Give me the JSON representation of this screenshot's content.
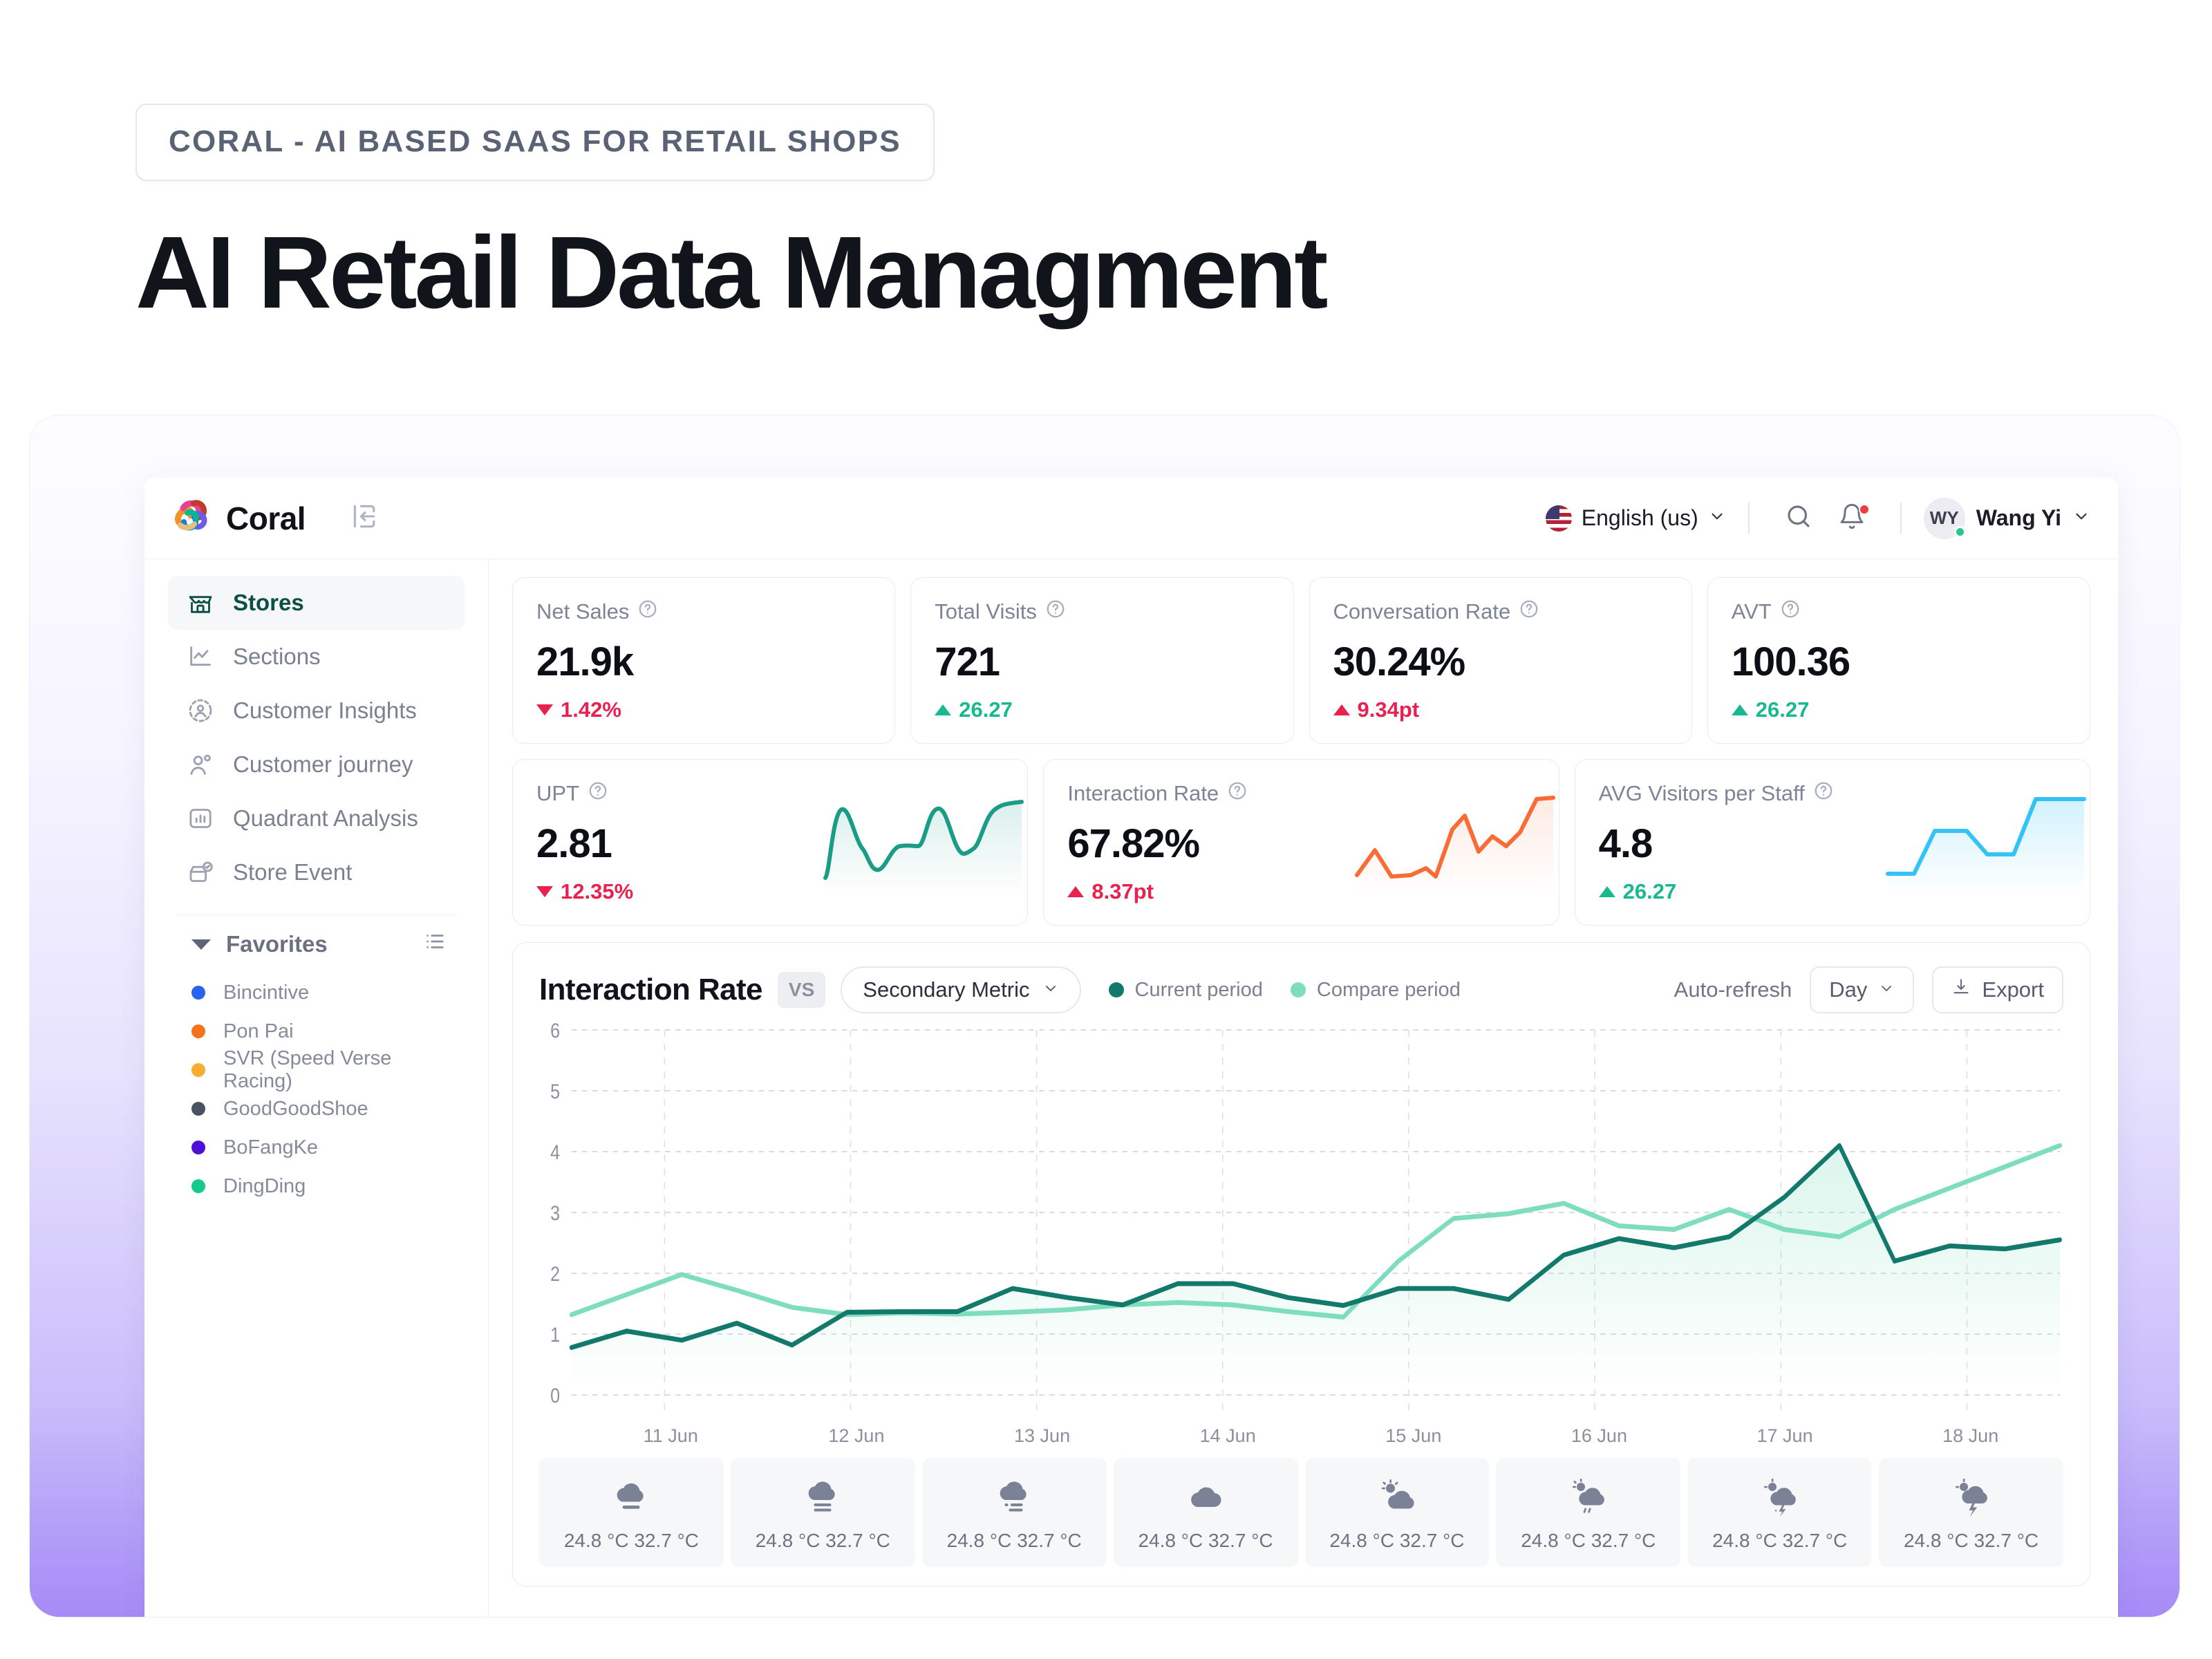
{
  "hero": {
    "eyebrow": "CORAL - AI BASED SAAS FOR RETAIL SHOPS",
    "title": "AI Retail Data Managment"
  },
  "topbar": {
    "brand": "Coral",
    "language": "English (us)",
    "user_initials": "WY",
    "user_name": "Wang Yi"
  },
  "sidebar": {
    "items": [
      {
        "label": "Stores",
        "icon": "store-icon",
        "active": true
      },
      {
        "label": "Sections",
        "icon": "chart-line-icon",
        "active": false
      },
      {
        "label": "Customer Insights",
        "icon": "user-circle-icon",
        "active": false
      },
      {
        "label": "Customer journey",
        "icon": "users-icon",
        "active": false
      },
      {
        "label": "Quadrant Analysis",
        "icon": "bar-chart-icon",
        "active": false
      },
      {
        "label": "Store Event",
        "icon": "store-check-icon",
        "active": false
      }
    ],
    "favorites_label": "Favorites",
    "favorites": [
      {
        "label": "Bincintive",
        "color": "#2563f0"
      },
      {
        "label": "Pon Pai",
        "color": "#f4731c"
      },
      {
        "label": "SVR (Speed Verse Racing)",
        "color": "#f5ad34"
      },
      {
        "label": "GoodGoodShoe",
        "color": "#4a5161"
      },
      {
        "label": "BoFangKe",
        "color": "#4d10d6"
      },
      {
        "label": "DingDing",
        "color": "#16c98d"
      }
    ]
  },
  "kpis": [
    {
      "label": "Net Sales",
      "value": "21.9k",
      "delta": "1.42%",
      "dir": "down",
      "tone": "down"
    },
    {
      "label": "Total Visits",
      "value": "721",
      "delta": "26.27",
      "dir": "up",
      "tone": "up"
    },
    {
      "label": "Conversation Rate",
      "value": "30.24%",
      "delta": "9.34pt",
      "dir": "up",
      "tone": "up-red"
    },
    {
      "label": "AVT",
      "value": "100.36",
      "delta": "26.27",
      "dir": "up",
      "tone": "up"
    }
  ],
  "spark_kpis": [
    {
      "label": "UPT",
      "value": "2.81",
      "delta": "12.35%",
      "dir": "down",
      "tone": "down",
      "color": "#1b9c86"
    },
    {
      "label": "Interaction Rate",
      "value": "67.82%",
      "delta": "8.37pt",
      "dir": "up",
      "tone": "up-red",
      "color": "#f96c36"
    },
    {
      "label": "AVG Visitors per Staff",
      "value": "4.8",
      "delta": "26.27",
      "dir": "up",
      "tone": "up",
      "color": "#34c3f5"
    }
  ],
  "chart_controls": {
    "title": "Interaction Rate",
    "vs": "VS",
    "secondary_metric": "Secondary Metric",
    "legend_current": "Current period",
    "legend_compare": "Compare period",
    "auto_refresh": "Auto-refresh",
    "granularity": "Day",
    "export": "Export",
    "color_current": "#12796b",
    "color_compare": "#7fddbf"
  },
  "chart_data": {
    "type": "line",
    "title": "Interaction Rate",
    "xlabel": "",
    "ylabel": "",
    "ylim": [
      0,
      6
    ],
    "yticks": [
      0,
      1,
      2,
      3,
      4,
      5,
      6
    ],
    "grid": true,
    "legend_position": "top",
    "tick_labels": [
      "11 Jun",
      "12 Jun",
      "13 Jun",
      "14 Jun",
      "15 Jun",
      "16 Jun",
      "17 Jun",
      "18 Jun"
    ],
    "x": [
      0,
      1,
      2,
      3,
      4,
      5,
      6,
      7,
      8,
      9,
      10,
      11,
      12,
      13,
      14,
      15,
      16,
      17,
      18,
      19,
      20,
      21,
      22,
      23,
      24
    ],
    "series": [
      {
        "name": "Current period",
        "color": "#12796b",
        "values": [
          0.78,
          1.05,
          0.9,
          1.18,
          0.82,
          1.36,
          1.37,
          1.37,
          1.75,
          1.6,
          1.48,
          1.83,
          1.83,
          1.6,
          1.47,
          1.75,
          1.75,
          1.57,
          2.3,
          2.57,
          2.42,
          2.6,
          3.25,
          4.1,
          2.2,
          2.45,
          2.4,
          2.55
        ]
      },
      {
        "name": "Compare period",
        "color": "#7fddbf",
        "values": [
          1.32,
          1.65,
          1.98,
          1.72,
          1.44,
          1.32,
          1.35,
          1.33,
          1.36,
          1.4,
          1.48,
          1.52,
          1.48,
          1.37,
          1.28,
          2.2,
          2.9,
          2.98,
          3.15,
          2.78,
          2.72,
          3.05,
          2.72,
          2.6,
          3.05,
          3.4,
          3.75,
          4.1
        ]
      }
    ]
  },
  "weather": [
    {
      "icon": "fog-icon",
      "temps": "24.8 °C 32.7 °C"
    },
    {
      "icon": "fog-heavy-icon",
      "temps": "24.8 °C 32.7 °C"
    },
    {
      "icon": "mist-icon",
      "temps": "24.8 °C 32.7 °C"
    },
    {
      "icon": "cloud-icon",
      "temps": "24.8 °C 32.7 °C"
    },
    {
      "icon": "sun-cloud-icon",
      "temps": "24.8 °C 32.7 °C"
    },
    {
      "icon": "sun-rain-icon",
      "temps": "24.8 °C 32.7 °C"
    },
    {
      "icon": "sun-sleet-icon",
      "temps": "24.8 °C 32.7 °C"
    },
    {
      "icon": "storm-icon",
      "temps": "24.8 °C 32.7 °C"
    }
  ]
}
